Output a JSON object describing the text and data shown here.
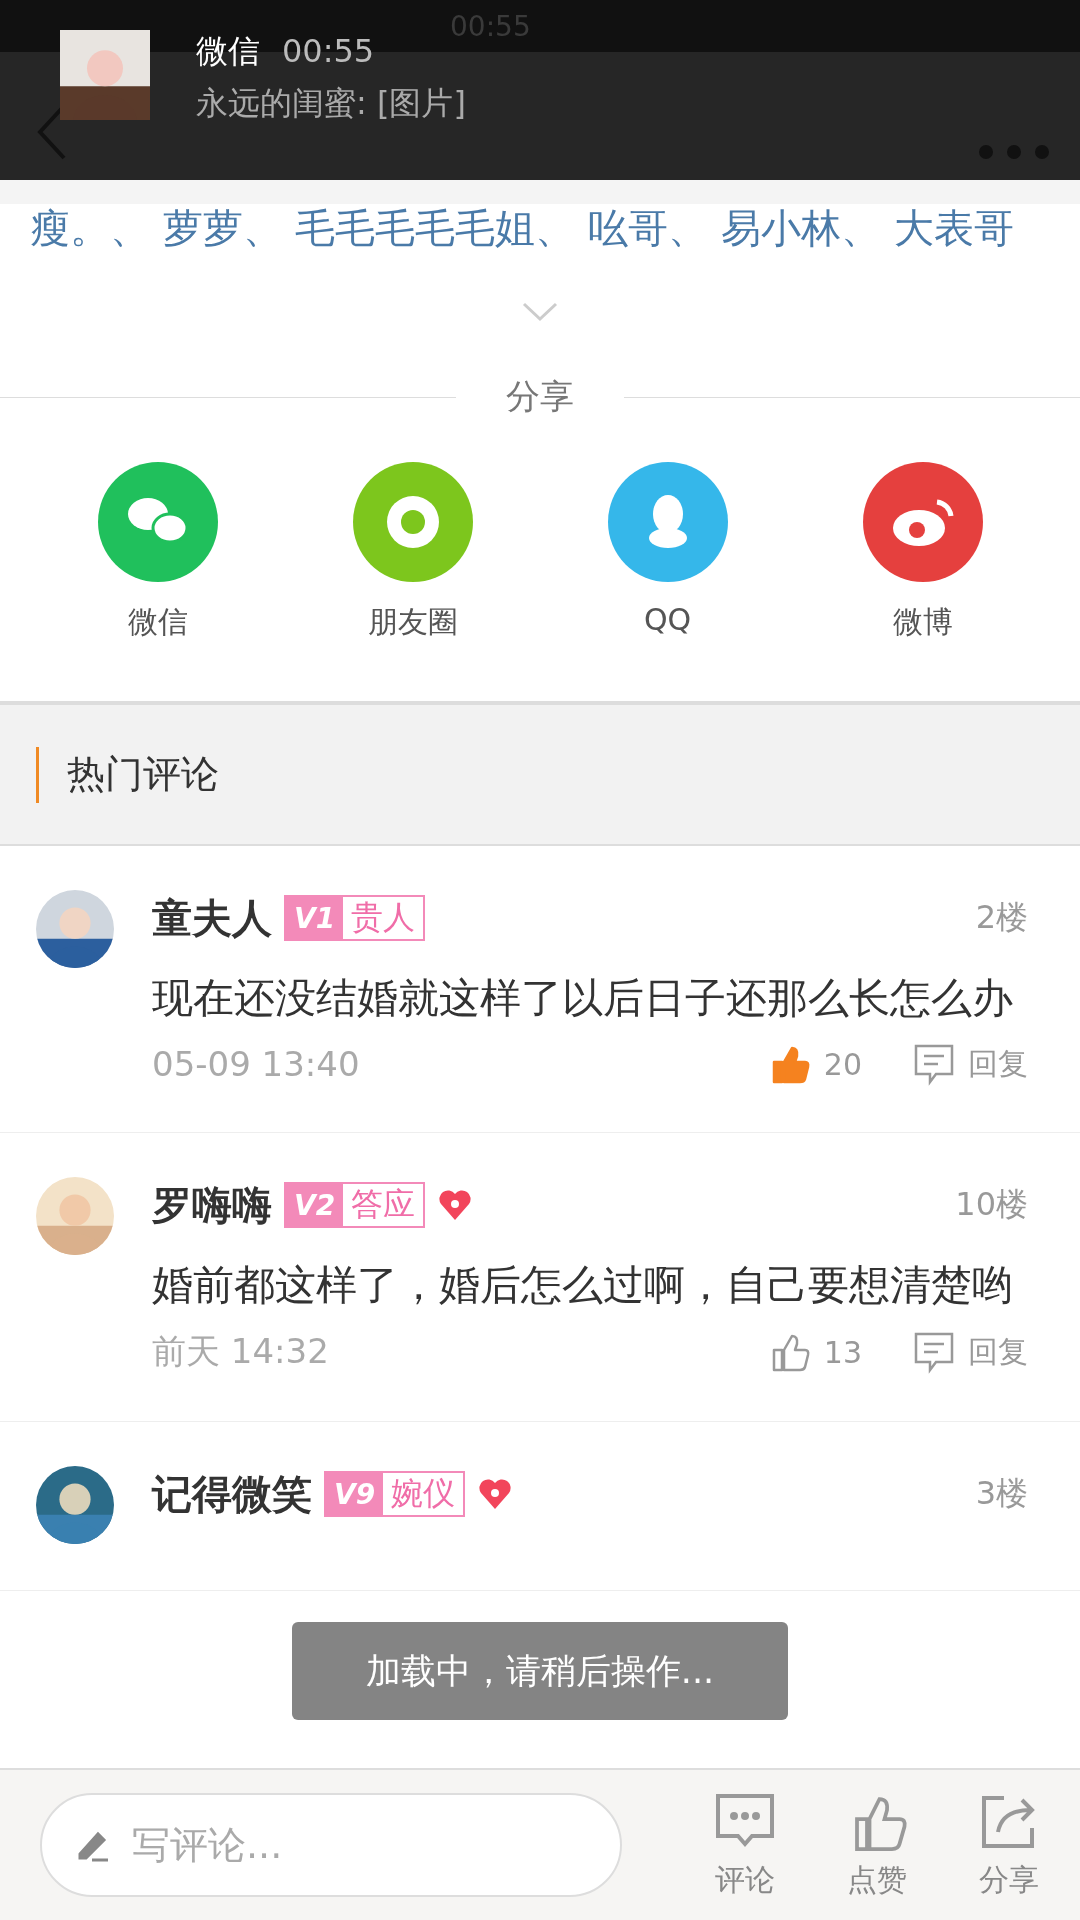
{
  "status_bar": {
    "time": "00:55"
  },
  "notification": {
    "app": "微信",
    "time": "00:55",
    "message": "永远的闺蜜: [图片]"
  },
  "likers": {
    "text": "瘦。、 萝萝、 毛毛毛毛毛姐、 吆哥、 易小林、 大表哥"
  },
  "share": {
    "title": "分享",
    "targets": [
      {
        "kind": "wechat",
        "label": "微信",
        "color": "#20c05c"
      },
      {
        "kind": "moments",
        "label": "朋友圈",
        "color": "#7dc61d"
      },
      {
        "kind": "qq",
        "label": "QQ",
        "color": "#35b7ea"
      },
      {
        "kind": "weibo",
        "label": "微博",
        "color": "#e5403e"
      }
    ]
  },
  "section": {
    "title": "热门评论"
  },
  "comments": [
    {
      "name": "童夫人",
      "level": "V1",
      "badge": "贵人",
      "heart": false,
      "floor": "2楼",
      "text": "现在还没结婚就这样了以后日子还那么长怎么办",
      "time": "05-09 13:40",
      "liked": true,
      "likes": "20",
      "reply": "回复"
    },
    {
      "name": "罗嗨嗨",
      "level": "V2",
      "badge": "答应",
      "heart": true,
      "floor": "10楼",
      "text": "婚前都这样了，婚后怎么过啊，自己要想清楚哟",
      "time": "前天 14:32",
      "liked": false,
      "likes": "13",
      "reply": "回复"
    },
    {
      "name": "记得微笑",
      "level": "V9",
      "badge": "婉仪",
      "heart": true,
      "floor": "3楼"
    }
  ],
  "toast": "加载中，请稍后操作...",
  "bottom_bar": {
    "placeholder": "写评论...",
    "actions": [
      {
        "kind": "comment",
        "label": "评论"
      },
      {
        "kind": "like",
        "label": "点赞"
      },
      {
        "kind": "share",
        "label": "分享"
      }
    ]
  }
}
